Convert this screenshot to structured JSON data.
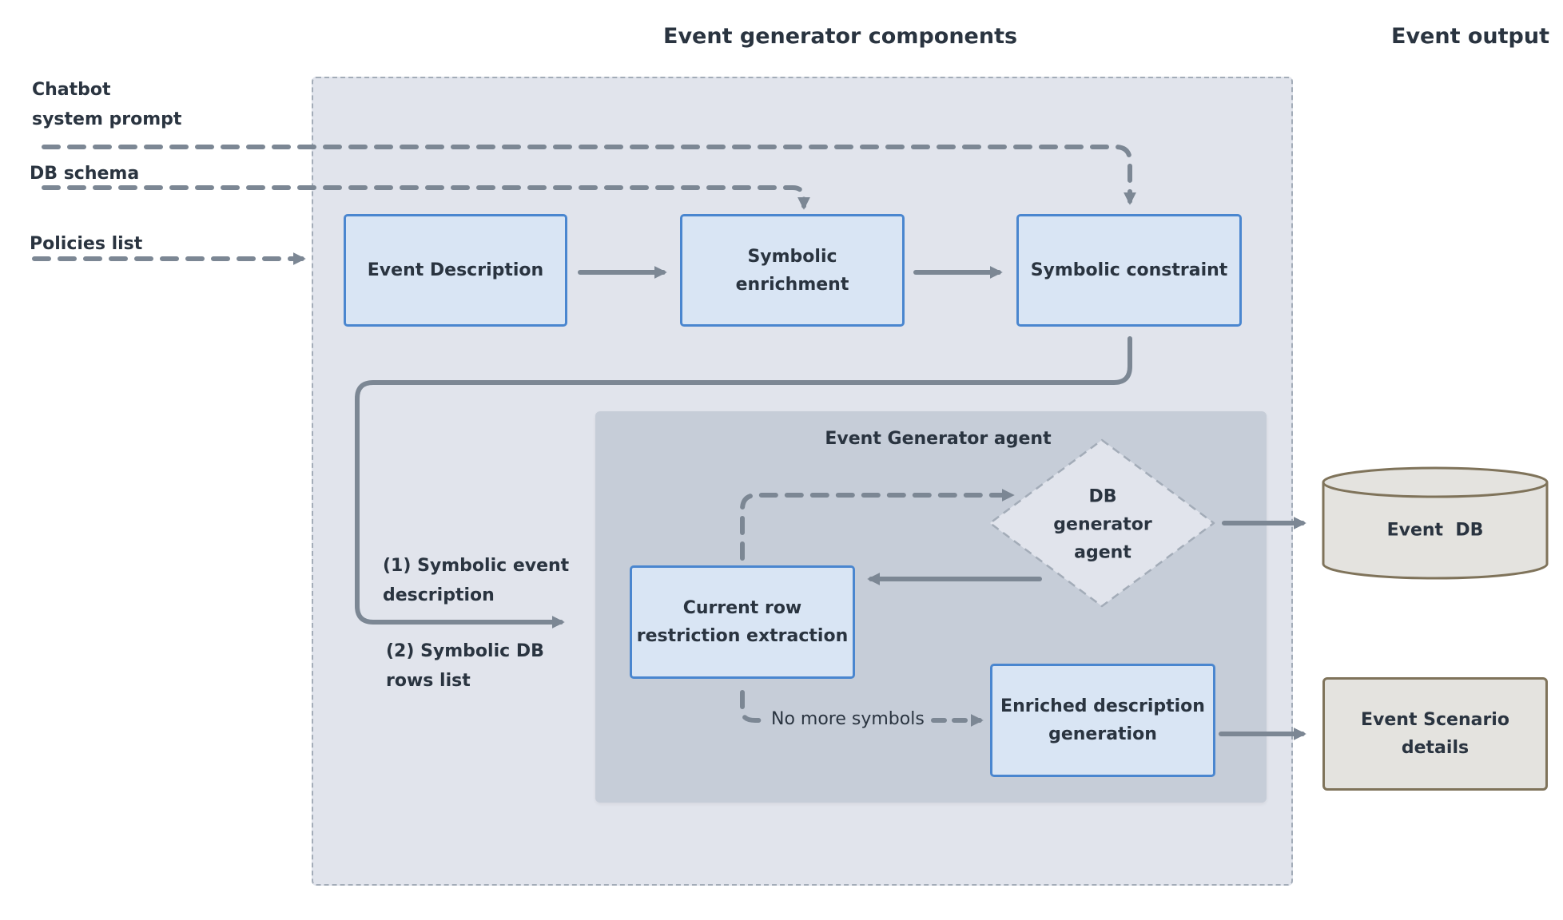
{
  "headings": {
    "components": "Event generator components",
    "output": "Event output"
  },
  "inputs": {
    "chatbot_prompt": [
      "Chatbot",
      "system prompt"
    ],
    "db_schema": "DB schema",
    "policies_list": "Policies list"
  },
  "pipeline": {
    "event_description": [
      "Event Description"
    ],
    "symbolic_enrichment": [
      "Symbolic",
      "enrichment"
    ],
    "symbolic_constraint": [
      "Symbolic constraint"
    ]
  },
  "flow_labels": {
    "symbolic_event_description": [
      "(1) Symbolic event",
      "description"
    ],
    "symbolic_db_rows": [
      "(2) Symbolic DB",
      "rows list"
    ]
  },
  "agent": {
    "title": "Event Generator agent",
    "db_generator": [
      "DB",
      "generator",
      "agent"
    ],
    "current_row": [
      "Current row",
      "restriction extraction"
    ],
    "enriched_description": [
      "Enriched description",
      "generation"
    ],
    "no_more_symbols": "No more symbols"
  },
  "outputs": {
    "event_db": "Event  DB",
    "event_scenario": [
      "Event Scenario",
      "details"
    ]
  },
  "colors": {
    "node_fill": "#d9e5f4",
    "node_border": "#4a86cf",
    "arrow": "#7c8794",
    "outer_fill": "#e1e4ec",
    "inner_fill": "#c6cdd8",
    "output_fill": "#e4e3df",
    "output_border": "#7f735a"
  }
}
